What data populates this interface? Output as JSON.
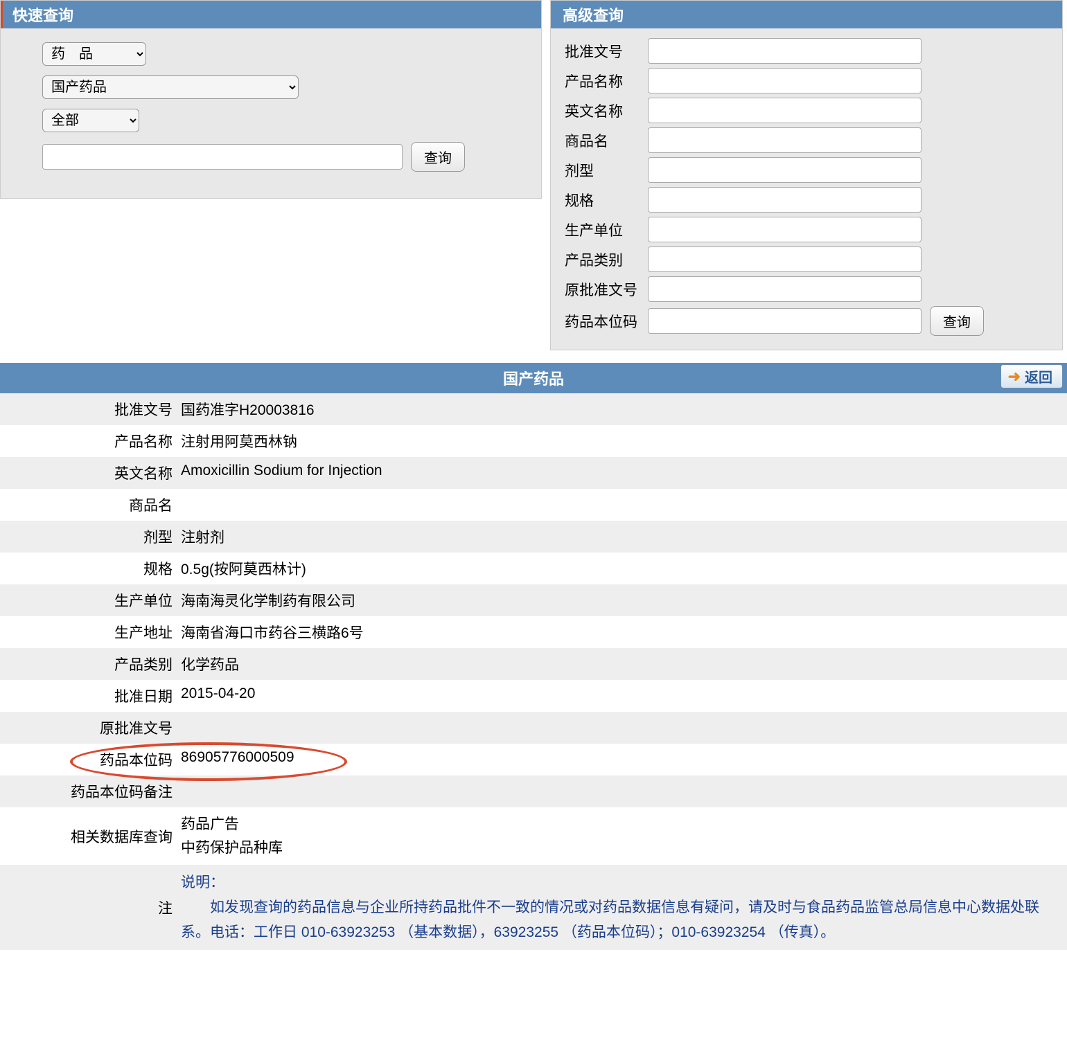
{
  "quick_search": {
    "title": "快速查询",
    "select1": "药　品",
    "select2": "国产药品",
    "select3": "全部",
    "input_value": "",
    "button": "查询"
  },
  "advanced_search": {
    "title": "高级查询",
    "fields": [
      {
        "label": "批准文号",
        "value": ""
      },
      {
        "label": "产品名称",
        "value": ""
      },
      {
        "label": "英文名称",
        "value": ""
      },
      {
        "label": "商品名",
        "value": ""
      },
      {
        "label": "剂型",
        "value": ""
      },
      {
        "label": "规格",
        "value": ""
      },
      {
        "label": "生产单位",
        "value": ""
      },
      {
        "label": "产品类别",
        "value": ""
      },
      {
        "label": "原批准文号",
        "value": ""
      },
      {
        "label": "药品本位码",
        "value": ""
      }
    ],
    "button": "查询"
  },
  "result": {
    "header": "国产药品",
    "back_button": "返回",
    "rows": [
      {
        "label": "批准文号",
        "value": "国药准字H20003816"
      },
      {
        "label": "产品名称",
        "value": "注射用阿莫西林钠"
      },
      {
        "label": "英文名称",
        "value": "Amoxicillin Sodium for Injection"
      },
      {
        "label": "商品名",
        "value": ""
      },
      {
        "label": "剂型",
        "value": "注射剂"
      },
      {
        "label": "规格",
        "value": "0.5g(按阿莫西林计)"
      },
      {
        "label": "生产单位",
        "value": "海南海灵化学制药有限公司"
      },
      {
        "label": "生产地址",
        "value": "海南省海口市药谷三横路6号"
      },
      {
        "label": "产品类别",
        "value": "化学药品"
      },
      {
        "label": "批准日期",
        "value": "2015-04-20"
      },
      {
        "label": "原批准文号",
        "value": ""
      },
      {
        "label": "药品本位码",
        "value": "86905776000509"
      },
      {
        "label": "药品本位码备注",
        "value": ""
      }
    ],
    "related_db": {
      "label": "相关数据库查询",
      "line1": "药品广告",
      "line2": "中药保护品种库"
    },
    "note": {
      "label": "注",
      "heading": "说明：",
      "body": "如发现查询的药品信息与企业所持药品批件不一致的情况或对药品数据信息有疑问，请及时与食品药品监管总局信息中心数据处联系。电话：工作日 010-63923253 （基本数据），63923255 （药品本位码）；010-63923254 （传真）。"
    }
  }
}
